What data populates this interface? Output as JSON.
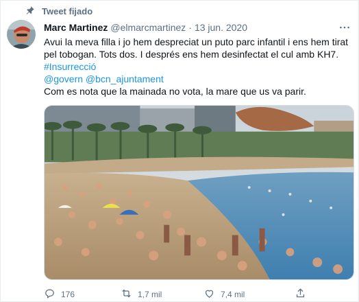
{
  "pinned": {
    "label": "Tweet fijado",
    "icon": "pin-icon"
  },
  "tweet": {
    "author_name": "Marc Martinez",
    "author_handle": "@elmarcmartinez",
    "separator": "·",
    "date": "13 jun. 2020",
    "text_line1": "Avui la meva filla i jo hem despreciat un puto parc infantil i ens hem tirat",
    "text_line2": "pel tobogan. Tots dos. I després ens hem desinfectat el cul amb KH7.",
    "hashtag": "#Insurrecció",
    "mention1": "@govern",
    "mention2": "@bcn_ajuntament",
    "closing_line": "Com es nota que la mainada no vota, la mare que us va parir."
  },
  "actions": {
    "reply_count": "176",
    "retweet_count": "1,7 mil",
    "like_count": "7,4 mil"
  },
  "colors": {
    "accent": "#1b95e0",
    "secondary_text": "#5b7083",
    "text": "#0f1419"
  }
}
